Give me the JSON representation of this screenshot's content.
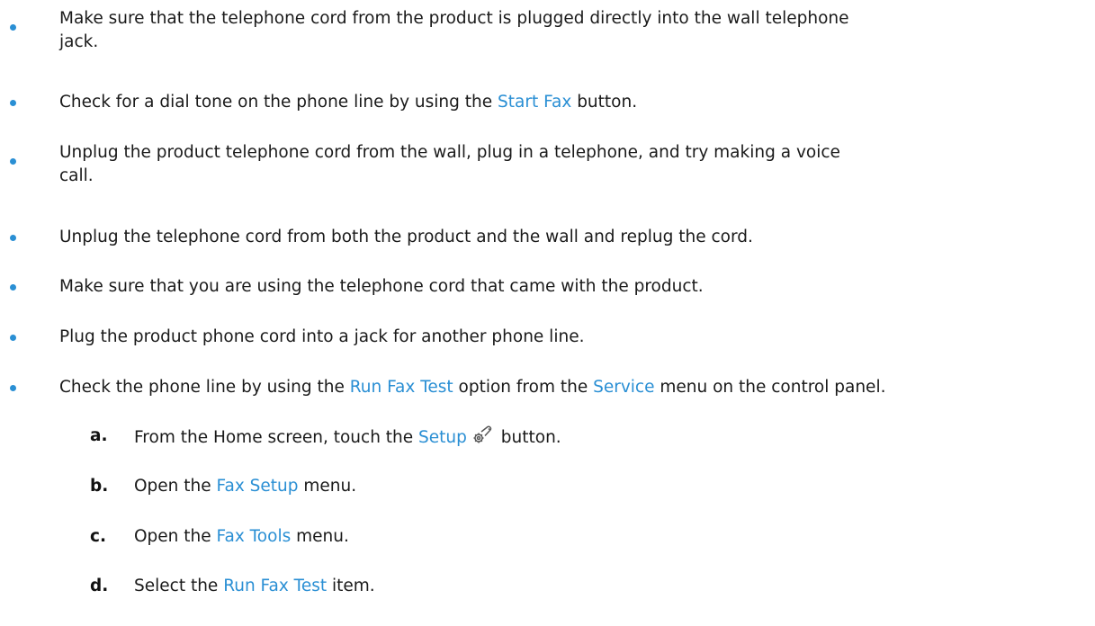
{
  "bullets": [
    {
      "lines": [
        "Make sure that the telephone cord from the product is plugged directly into the wall telephone",
        "jack."
      ]
    },
    {
      "before": "Check for a dial tone on the phone line by using the ",
      "link": "Start Fax",
      "after": " button."
    },
    {
      "lines": [
        "Unplug the product telephone cord from the wall, plug in a telephone, and try making a voice",
        "call."
      ]
    },
    {
      "text": "Unplug the telephone cord from both the product and the wall and replug the cord."
    },
    {
      "text": "Make sure that you are using the telephone cord that came with the product."
    },
    {
      "text": "Plug the product phone cord into a jack for another phone line."
    },
    {
      "before": "Check the phone line by using the ",
      "link1": "Run Fax Test",
      "middle": " option from the ",
      "link2": "Service",
      "after": " menu on the control panel."
    }
  ],
  "steps": [
    {
      "letter": "a.",
      "before": "From the Home screen, touch the ",
      "link": "Setup",
      "after": " button.",
      "icon": "wrench-gear-icon"
    },
    {
      "letter": "b.",
      "before": "Open the ",
      "link": "Fax Setup",
      "after": " menu."
    },
    {
      "letter": "c.",
      "before": "Open the ",
      "link": "Fax Tools",
      "after": " menu."
    },
    {
      "letter": "d.",
      "before": "Select the ",
      "link": "Run Fax Test",
      "after": " item."
    }
  ],
  "colors": {
    "accent": "#2a8fd4",
    "text": "#1a1a1a"
  }
}
